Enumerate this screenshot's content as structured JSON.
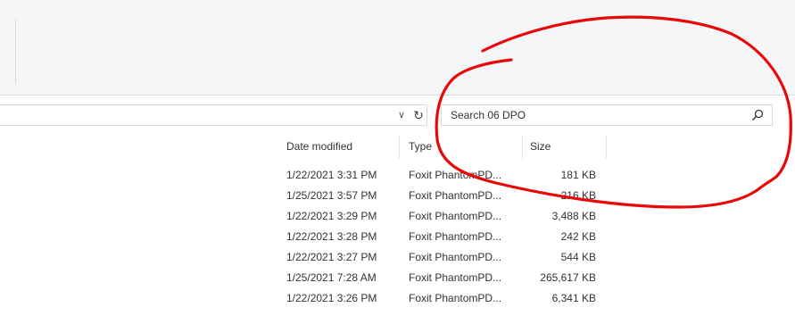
{
  "search": {
    "placeholder": "Search 06 DPO"
  },
  "columns": {
    "date": "Date modified",
    "type": "Type",
    "size": "Size"
  },
  "files": [
    {
      "date": "1/22/2021 3:31 PM",
      "type": "Foxit PhantomPD...",
      "size": "181 KB"
    },
    {
      "date": "1/25/2021 3:57 PM",
      "type": "Foxit PhantomPD...",
      "size": "216 KB"
    },
    {
      "date": "1/22/2021 3:29 PM",
      "type": "Foxit PhantomPD...",
      "size": "3,488 KB"
    },
    {
      "date": "1/22/2021 3:28 PM",
      "type": "Foxit PhantomPD...",
      "size": "242 KB"
    },
    {
      "date": "1/22/2021 3:27 PM",
      "type": "Foxit PhantomPD...",
      "size": "544 KB"
    },
    {
      "date": "1/25/2021 7:28 AM",
      "type": "Foxit PhantomPD...",
      "size": "265,617 KB"
    },
    {
      "date": "1/22/2021 3:26 PM",
      "type": "Foxit PhantomPD...",
      "size": "6,341 KB"
    }
  ],
  "colors": {
    "annotation": "#e8080a",
    "ribbon_bg": "#f5f6f7"
  },
  "icons": {
    "dropdown": "chevron-down-icon",
    "refresh": "refresh-icon",
    "search": "search-icon"
  }
}
